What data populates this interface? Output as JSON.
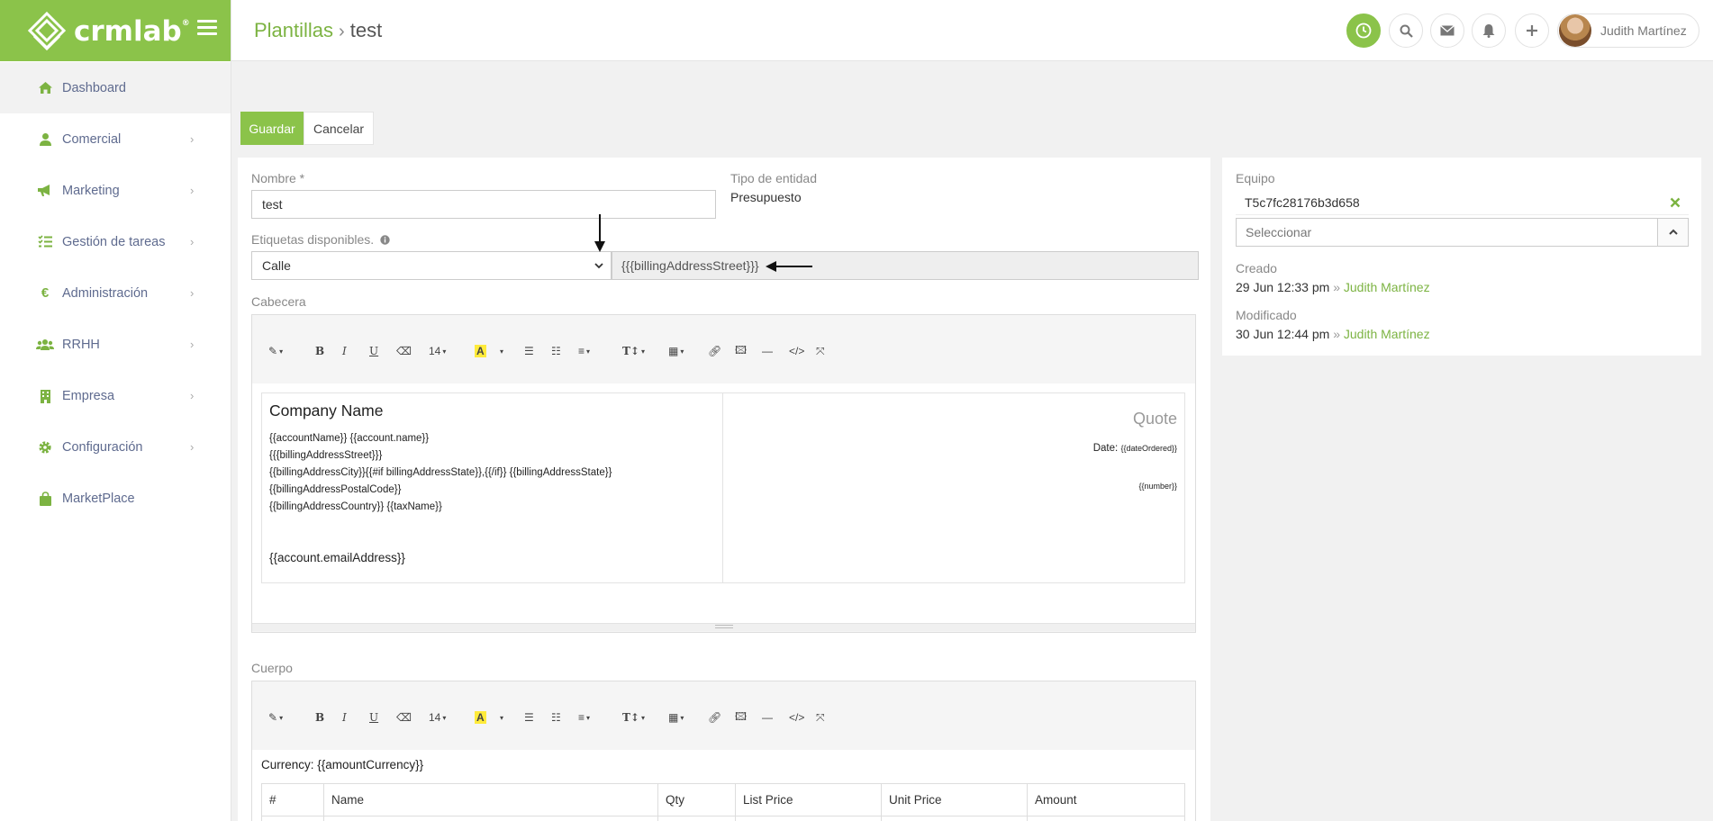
{
  "brand": {
    "name": "crmlab",
    "reg": "®"
  },
  "sidebar": {
    "items": [
      {
        "label": "Dashboard",
        "icon": "home-icon"
      },
      {
        "label": "Comercial",
        "icon": "user-icon"
      },
      {
        "label": "Marketing",
        "icon": "megaphone-icon"
      },
      {
        "label": "Gestión de tareas",
        "icon": "tasks-icon"
      },
      {
        "label": "Administración",
        "icon": "euro-icon"
      },
      {
        "label": "RRHH",
        "icon": "users-icon"
      },
      {
        "label": "Empresa",
        "icon": "building-icon"
      },
      {
        "label": "Configuración",
        "icon": "gear-icon"
      },
      {
        "label": "MarketPlace",
        "icon": "shopping-bag-icon"
      }
    ]
  },
  "header": {
    "breadcrumb_root": "Plantillas",
    "breadcrumb_sep": "›",
    "breadcrumb_current": "test",
    "user_name": "Judith Martínez"
  },
  "actions": {
    "save": "Guardar",
    "cancel": "Cancelar"
  },
  "form": {
    "name_label": "Nombre *",
    "name_value": "test",
    "entity_type_label": "Tipo de entidad",
    "entity_type_value": "Presupuesto",
    "tags_label": "Etiquetas disponibles.",
    "tags_select_value": "Calle",
    "tags_output": "{{{billingAddressStreet}}}",
    "header_label": "Cabecera",
    "body_label": "Cuerpo"
  },
  "editor_toolbar": {
    "font_size": "14"
  },
  "header_doc": {
    "company_name": "Company Name",
    "lines": [
      "{{accountName}} {{account.name}}",
      "{{{billingAddressStreet}}}",
      "{{billingAddressCity}}{{#if billingAddressState}},{{/if}} {{billingAddressState}}",
      "{{billingAddressPostalCode}}",
      "{{billingAddressCountry}}  {{taxName}}"
    ],
    "email": "{{account.emailAddress}}",
    "quote_title": "Quote",
    "date_label": "Date:",
    "date_value": "{{dateOrdered}}",
    "number": "{{number}}"
  },
  "body_doc": {
    "currency_line": "Currency: {{amountCurrency}}",
    "columns": [
      "#",
      "Name",
      "Qty",
      "List Price",
      "Unit Price",
      "Amount"
    ]
  },
  "side": {
    "team_label": "Equipo",
    "team_value": "T5c7fc28176b3d658",
    "team_placeholder": "Seleccionar",
    "created_label": "Creado",
    "created_date": "29 Jun 12:33 pm",
    "modified_label": "Modificado",
    "modified_date": "30 Jun 12:44 pm",
    "sep": "»",
    "user": "Judith Martínez"
  },
  "colors": {
    "accent": "#8bc34a",
    "link": "#7cb342",
    "nav_text": "#5f6b8f"
  }
}
